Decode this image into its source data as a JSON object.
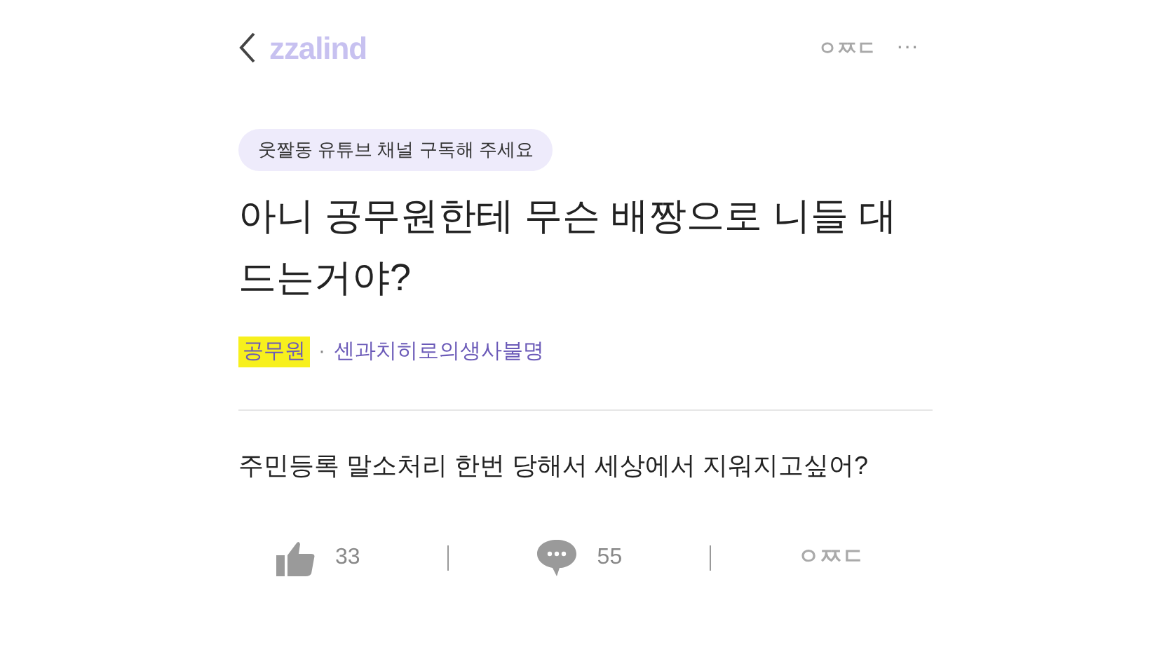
{
  "header": {
    "logo": "zzalind",
    "brand_mark": "ㅇㅉㄷ",
    "more": "···"
  },
  "tag": "웃짤동 유튜브 채널 구독해 주세요",
  "title": "아니 공무원한테 무슨 배짱으로 니들 대드는거야?",
  "author": {
    "name": "공무원",
    "highlighted": true,
    "separator": "·",
    "group": "센과치히로의생사불명"
  },
  "body": "주민등록 말소처리 한번 당해서 세상에서 지워지고싶어?",
  "actions": [
    {
      "kind": "like",
      "count": "33"
    },
    {
      "kind": "comment",
      "count": "55"
    },
    {
      "kind": "brand",
      "label": "ㅇㅉㄷ"
    }
  ]
}
